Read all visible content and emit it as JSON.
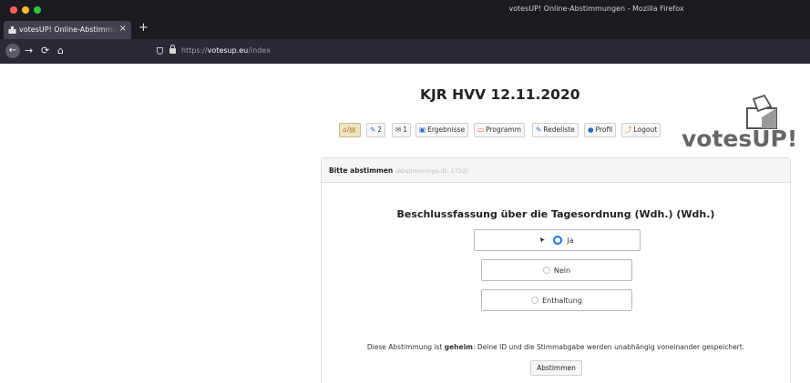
{
  "window": {
    "title": "votesUP! Online-Abstimmungen - Mozilla Firefox"
  },
  "tab": {
    "title": "votesUP! Online-Abstimmungen",
    "close": "×",
    "new_tab": "+"
  },
  "nav": {
    "back": "←",
    "forward": "→",
    "reload": "⟳",
    "home": "⌂",
    "url_prefix": "https://",
    "url_host": "votesup.eu",
    "url_path": "/index"
  },
  "header": {
    "title": "KJR HVV 12.11.2020"
  },
  "menu": {
    "items": [
      {
        "icon": "⌂/▤",
        "label": ""
      },
      {
        "icon": "✎",
        "label": "2"
      },
      {
        "icon": "✉",
        "label": "1"
      },
      {
        "icon": "▣",
        "label": "Ergebnisse"
      },
      {
        "icon": "▭",
        "label": "Programm"
      },
      {
        "icon": "✎",
        "label": "Redeliste"
      },
      {
        "icon": "●",
        "label": "Profil"
      },
      {
        "icon": "⤴",
        "label": "Logout"
      }
    ]
  },
  "logo": {
    "text": "votesUP!"
  },
  "panel": {
    "title": "Bitte abstimmen",
    "vote_id": "(Abstimmungs-ID: 1722)",
    "question": "Beschlussfassung über die Tagesordnung (Wdh.) (Wdh.)",
    "options": [
      "Ja",
      "Nein",
      "Enthaltung"
    ],
    "note_before": "Diese Abstimmung ist ",
    "note_bold": "geheim",
    "note_after": ": Deine ID und die Stimmabgabe werden unabhängig voneinander gespeichert.",
    "submit_label": "Abstimmen"
  },
  "colors": {
    "browser_chrome": "#1c1b22",
    "toolbar": "#2b2a33",
    "radio_selected": "#1a73e8",
    "active_menu": "#ece3c4"
  }
}
